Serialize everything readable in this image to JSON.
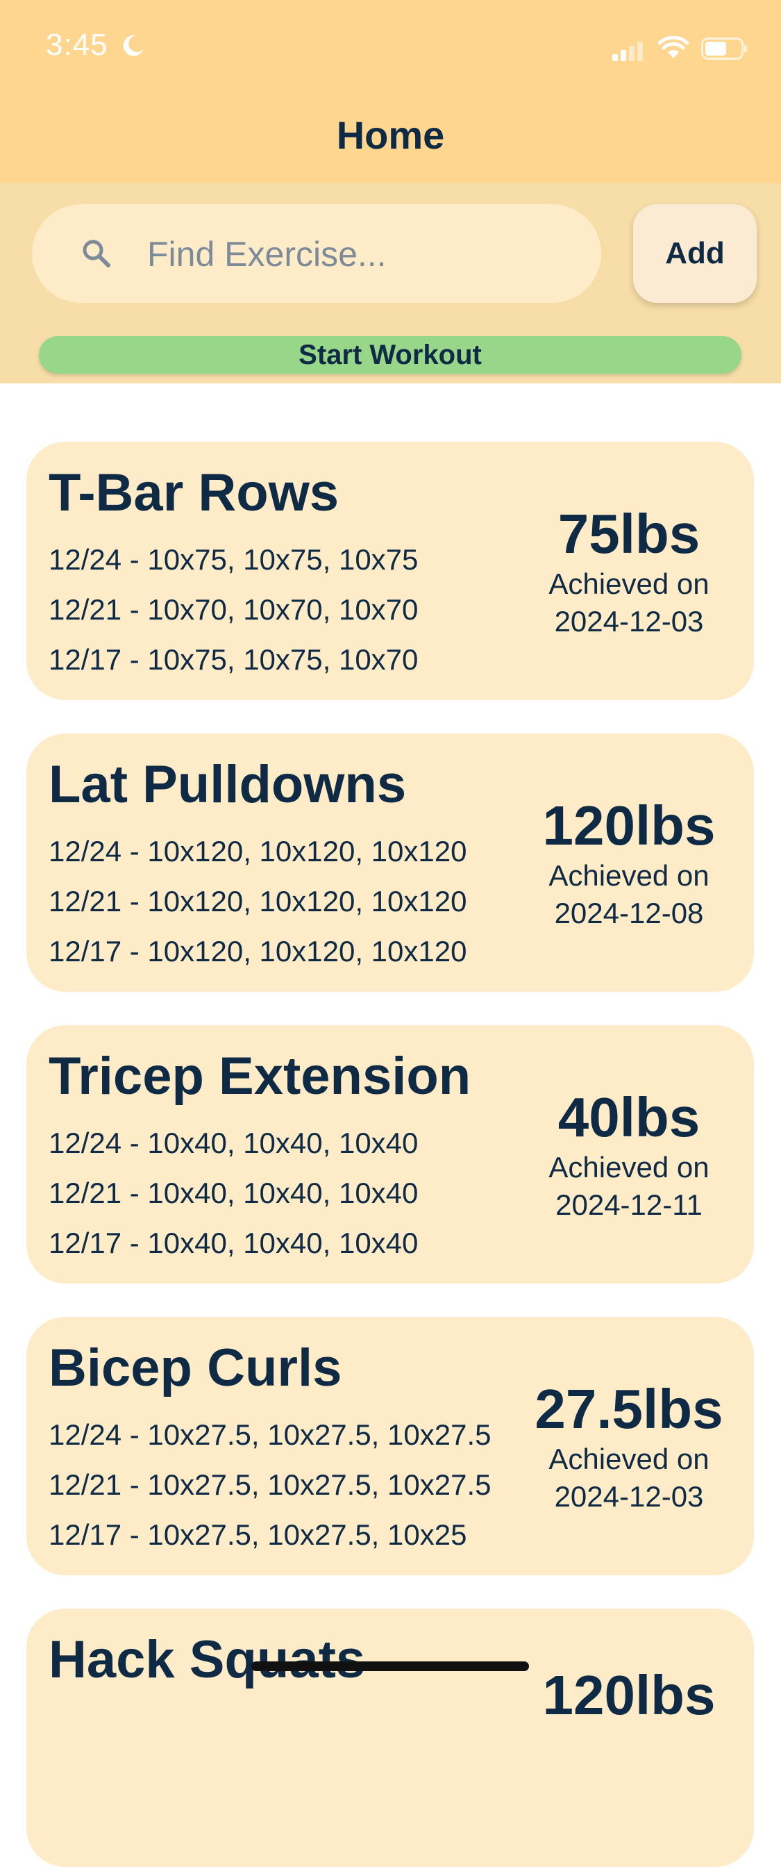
{
  "status_bar": {
    "time": "3:45"
  },
  "nav": {
    "title": "Home"
  },
  "search": {
    "placeholder": "Find Exercise..."
  },
  "toolbar": {
    "add_label": "Add",
    "start_label": "Start Workout"
  },
  "exercises": [
    {
      "name": "T-Bar Rows",
      "sets": [
        "12/24 - 10x75, 10x75, 10x75",
        "12/21 - 10x70, 10x70, 10x70",
        "12/17 - 10x75, 10x75, 10x70"
      ],
      "pr_weight": "75lbs",
      "pr_achieved_label": "Achieved on",
      "pr_date": "2024-12-03"
    },
    {
      "name": "Lat Pulldowns",
      "sets": [
        "12/24 - 10x120, 10x120, 10x120",
        "12/21 - 10x120, 10x120, 10x120",
        "12/17 - 10x120, 10x120, 10x120"
      ],
      "pr_weight": "120lbs",
      "pr_achieved_label": "Achieved on",
      "pr_date": "2024-12-08"
    },
    {
      "name": "Tricep Extension",
      "sets": [
        "12/24 - 10x40, 10x40, 10x40",
        "12/21 - 10x40, 10x40, 10x40",
        "12/17 - 10x40, 10x40, 10x40"
      ],
      "pr_weight": "40lbs",
      "pr_achieved_label": "Achieved on",
      "pr_date": "2024-12-11"
    },
    {
      "name": "Bicep Curls",
      "sets": [
        "12/24 - 10x27.5, 10x27.5, 10x27.5",
        "12/21 - 10x27.5, 10x27.5, 10x27.5",
        "12/17 - 10x27.5, 10x27.5, 10x25"
      ],
      "pr_weight": "27.5lbs",
      "pr_achieved_label": "Achieved on",
      "pr_date": "2024-12-03"
    },
    {
      "name": "Hack Squats",
      "pr_weight": "120lbs"
    }
  ],
  "colors": {
    "header": "#fed68f",
    "toolbar": "#f7dea8",
    "card": "#feecc8",
    "start_button": "#98d68a",
    "text": "#0f2a44"
  },
  "icons": [
    "moon-icon",
    "cellular-signal-icon",
    "wifi-icon",
    "battery-icon",
    "search-icon"
  ]
}
